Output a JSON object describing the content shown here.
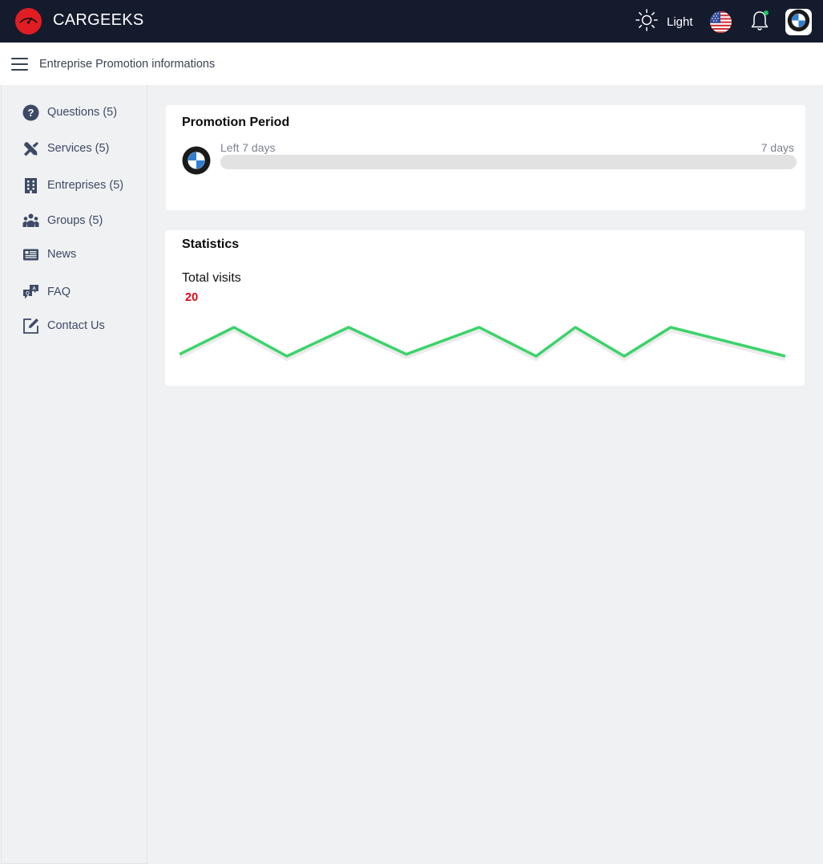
{
  "app": {
    "brand": "CARGEEKS",
    "theme_label": "Light",
    "notification_dot_color": "#22c55e",
    "brand_color": "#e11d24"
  },
  "header": {
    "page_title": "Entreprise Promotion informations"
  },
  "sidebar": {
    "items": [
      {
        "label": "Questions (5)",
        "icon": "question-circle-icon"
      },
      {
        "label": "Services (5)",
        "icon": "tools-icon"
      },
      {
        "label": "Entreprises (5)",
        "icon": "building-icon"
      },
      {
        "label": "Groups (5)",
        "icon": "users-group-icon"
      },
      {
        "label": "News",
        "icon": "newspaper-icon"
      },
      {
        "label": "FAQ",
        "icon": "faq-chat-icon"
      },
      {
        "label": "Contact Us",
        "icon": "edit-square-icon"
      }
    ]
  },
  "promotion": {
    "title": "Promotion Period",
    "left_label": "Left 7 days",
    "right_label": "7 days",
    "progress_fraction": 0,
    "brand_icon": "bmw-logo-icon"
  },
  "statistics": {
    "title": "Statistics",
    "metric_label": "Total visits",
    "metric_value": "20",
    "line_color": "#3cd36b",
    "sparkline_values": [
      6,
      34,
      4,
      34,
      6,
      34,
      4,
      34,
      4,
      34,
      4
    ]
  }
}
